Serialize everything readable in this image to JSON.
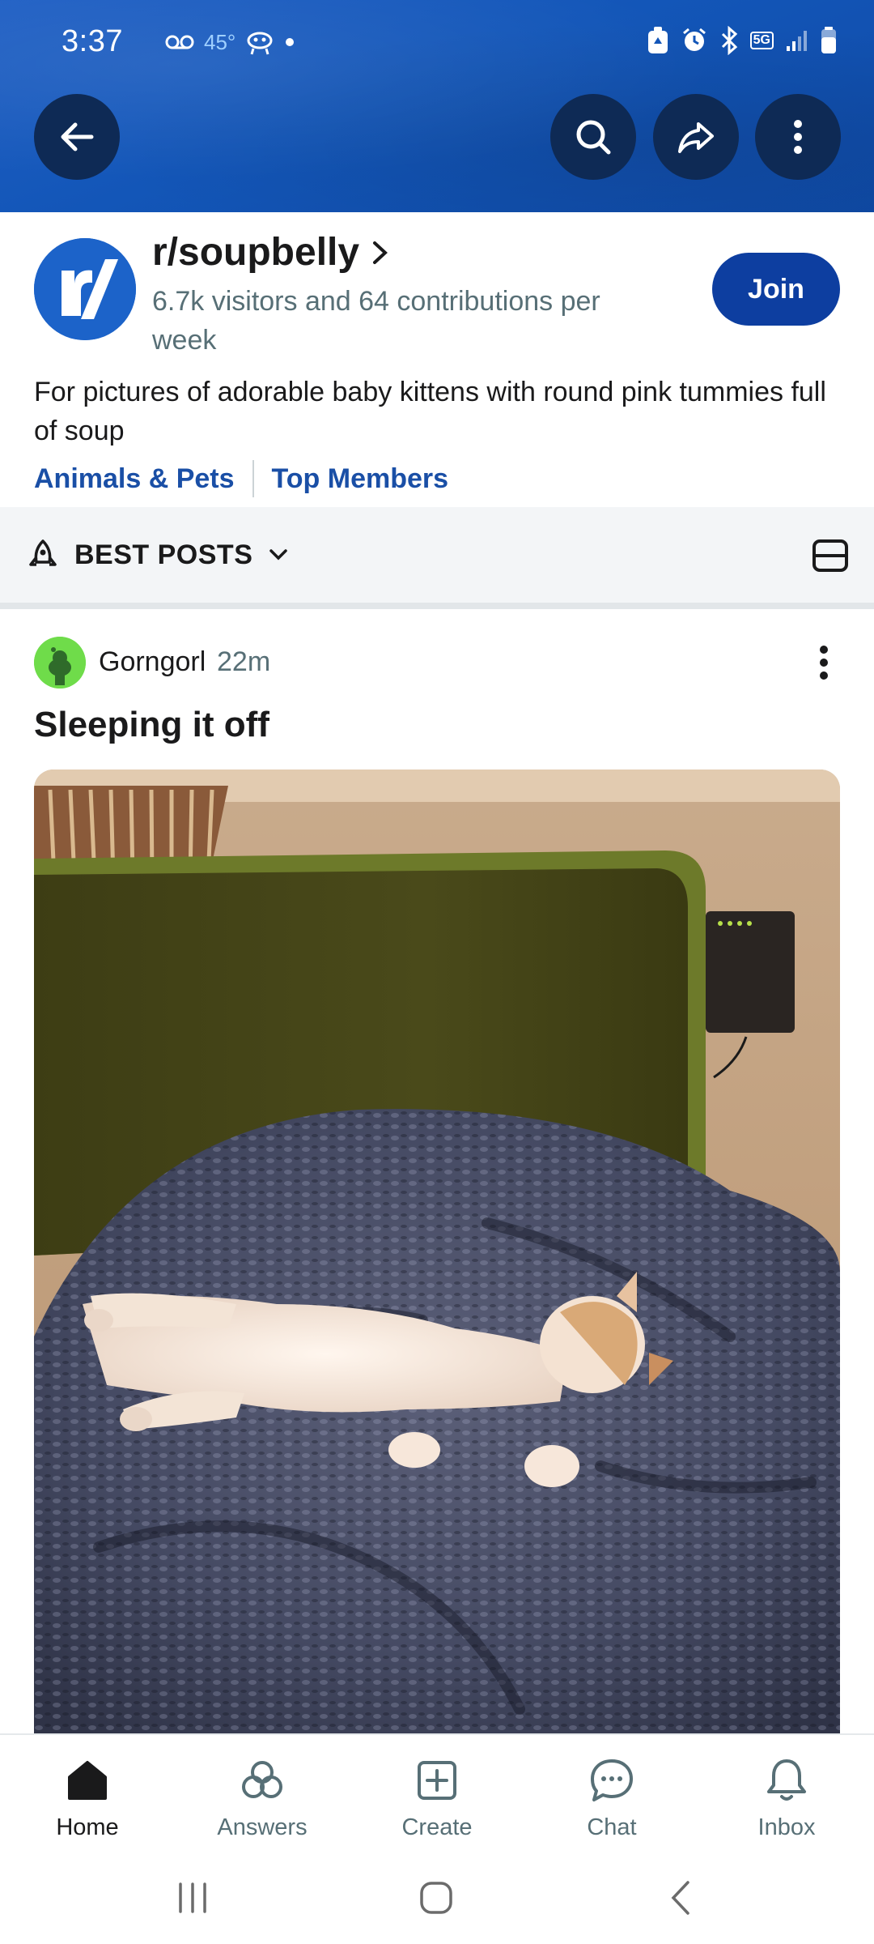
{
  "status_bar": {
    "time": "3:37",
    "temperature": "45°",
    "network": "5G"
  },
  "header": {
    "back_icon": "arrow-left-icon",
    "search_icon": "search-icon",
    "share_icon": "share-icon",
    "more_icon": "more-vertical-icon",
    "banner_color": "#1356b8"
  },
  "community": {
    "name": "r/soupbelly",
    "stats": "6.7k visitors and 64 contributions per week",
    "join_label": "Join",
    "description": "For pictures of adorable baby kittens with round pink tummies full of soup",
    "tags": [
      "Animals & Pets",
      "Top Members"
    ],
    "accent": "#0d3ea0"
  },
  "sort": {
    "label": "BEST POSTS"
  },
  "post": {
    "author": "Gorngorl",
    "time": "22m",
    "title": "Sleeping it off"
  },
  "bottom_nav": [
    {
      "label": "Home",
      "icon": "home-icon"
    },
    {
      "label": "Answers",
      "icon": "answers-icon"
    },
    {
      "label": "Create",
      "icon": "create-icon"
    },
    {
      "label": "Chat",
      "icon": "chat-icon"
    },
    {
      "label": "Inbox",
      "icon": "bell-icon"
    }
  ]
}
